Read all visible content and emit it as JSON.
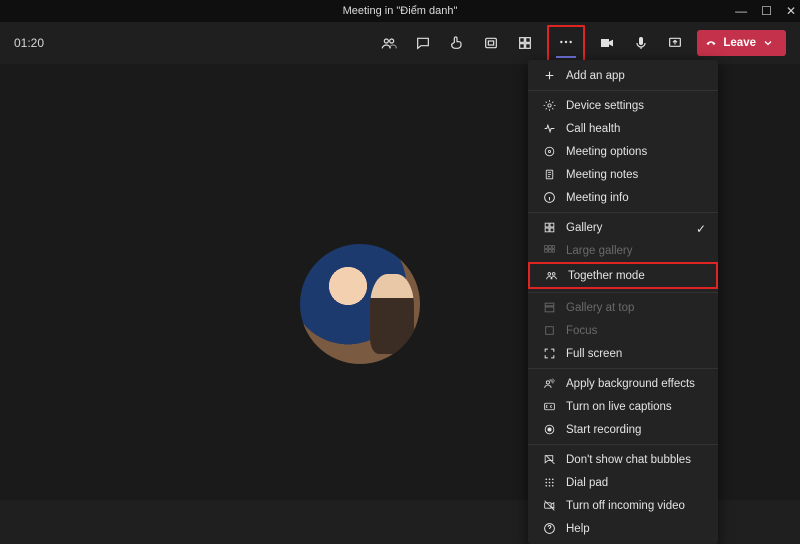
{
  "titlebar": {
    "title": "Meeting in \"Điểm danh\""
  },
  "meeting": {
    "timer": "01:20"
  },
  "leave": {
    "label": "Leave"
  },
  "menu": {
    "add_app": "Add an app",
    "device_settings": "Device settings",
    "call_health": "Call health",
    "meeting_options": "Meeting options",
    "meeting_notes": "Meeting notes",
    "meeting_info": "Meeting info",
    "gallery": "Gallery",
    "large_gallery": "Large gallery",
    "together_mode": "Together mode",
    "gallery_at_top": "Gallery at top",
    "focus": "Focus",
    "full_screen": "Full screen",
    "apply_bg": "Apply background effects",
    "live_captions": "Turn on live captions",
    "start_recording": "Start recording",
    "chat_bubbles": "Don't show chat bubbles",
    "dial_pad": "Dial pad",
    "incoming_video": "Turn off incoming video",
    "help": "Help"
  }
}
